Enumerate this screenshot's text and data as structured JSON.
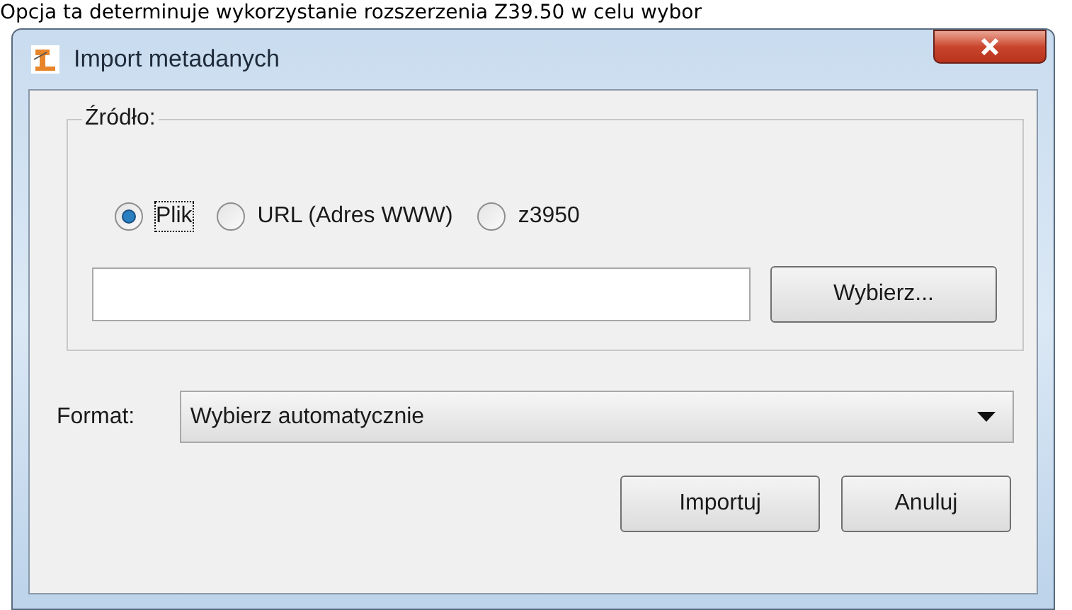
{
  "background_text": "Opcja ta determinuje wykorzystanie rozszerzenia Z39.50 w celu wybor",
  "window": {
    "title": "Import metadanych"
  },
  "source": {
    "legend": "Źródło:",
    "options": [
      {
        "label": "Plik",
        "selected": true,
        "focused": true
      },
      {
        "label": "URL (Adres WWW)",
        "selected": false,
        "focused": false
      },
      {
        "label": "z3950",
        "selected": false,
        "focused": false
      }
    ],
    "choose_button": "Wybierz..."
  },
  "format": {
    "label": "Format:",
    "value": "Wybierz automatycznie"
  },
  "buttons": [
    "Importuj",
    "Anuluj"
  ]
}
